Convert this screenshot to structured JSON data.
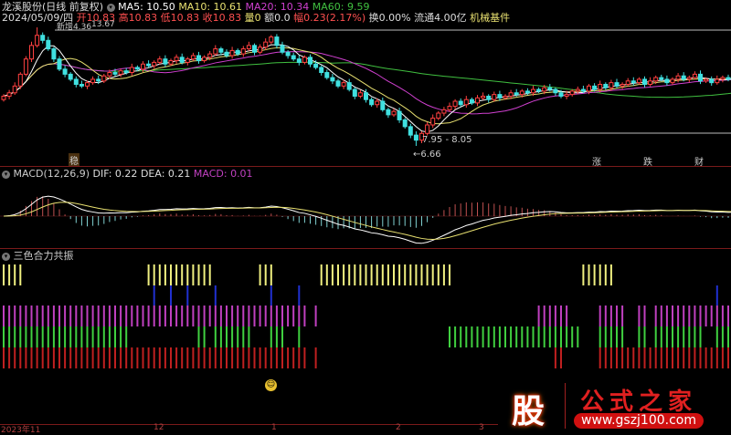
{
  "header": {
    "stock_name": "龙溪股份(日线 前复权)",
    "ma5": "MA5: 10.50",
    "ma10": "MA10: 10.61",
    "ma20": "MA20: 10.34",
    "ma60": "MA60: 9.59",
    "date": "2024/05/09/四",
    "open": "开10.83",
    "high": "高10.83",
    "low": "低10.83",
    "close": "收10.83",
    "volume": "量0",
    "amount": "额0.0",
    "change": "幅0.23(2.17%)",
    "turnover": "换0.00%",
    "float": "流通4.00亿",
    "sector": "机械基件"
  },
  "main_chart": {
    "high_label": "13.67",
    "low_label": "6.66",
    "range_label": "7.95 - 8.05",
    "top_note": "新增4.36",
    "signal_labels": [
      {
        "text": "稳",
        "color": "#d9a860"
      },
      {
        "text": "涨",
        "color": "#e05050"
      },
      {
        "text": "跌",
        "color": "#40d040"
      },
      {
        "text": "财",
        "color": "#80a8ff"
      }
    ],
    "closes": [
      9.6,
      9.8,
      10.2,
      10.9,
      11.8,
      12.6,
      13.2,
      12.9,
      12.4,
      11.8,
      11.2,
      10.9,
      10.6,
      10.3,
      10.2,
      10.4,
      10.6,
      10.5,
      10.8,
      11.0,
      10.9,
      11.1,
      11.0,
      11.3,
      11.2,
      11.5,
      11.4,
      11.6,
      11.8,
      11.5,
      11.7,
      11.9,
      11.6,
      11.8,
      12.0,
      11.7,
      11.9,
      12.1,
      12.4,
      12.2,
      12.0,
      12.3,
      12.1,
      12.4,
      12.6,
      12.2,
      12.5,
      12.8,
      13.1,
      12.6,
      12.2,
      12.0,
      11.8,
      11.6,
      11.9,
      11.5,
      11.3,
      11.0,
      10.7,
      10.5,
      10.2,
      10.4,
      10.0,
      9.6,
      9.8,
      9.4,
      9.1,
      9.3,
      8.8,
      8.5,
      8.7,
      8.2,
      7.8,
      7.3,
      7.0,
      7.4,
      7.9,
      8.3,
      8.6,
      8.8,
      9.0,
      9.3,
      9.1,
      9.4,
      9.2,
      9.5,
      9.6,
      9.4,
      9.7,
      9.5,
      9.6,
      9.8,
      9.7,
      9.9,
      9.8,
      10.0,
      9.9,
      10.1,
      10.0,
      9.8,
      9.6,
      9.7,
      9.9,
      10.0,
      9.9,
      10.2,
      10.0,
      10.3,
      10.1,
      10.4,
      10.2,
      10.3,
      10.5,
      10.4,
      10.6,
      10.3,
      10.5,
      10.7,
      10.6,
      10.4,
      10.6,
      10.8,
      10.6,
      10.7,
      10.9,
      10.5,
      10.6,
      10.4,
      10.6,
      10.7,
      10.6,
      10.83
    ],
    "colors": {
      "up": "#ff4040",
      "down": "#40e0e0",
      "ma5": "#ffffff",
      "ma10": "#e8e070",
      "ma20": "#d040d0",
      "ma60": "#40c040"
    }
  },
  "macd": {
    "title": "MACD(12,26,9)",
    "dif": "DIF: 0.22",
    "dea": "DEA: 0.21",
    "macd": "MACD: 0.01"
  },
  "tricolor": {
    "title": "三色合力共振",
    "rows": [
      {
        "name": "yellow",
        "color": "#f0f080",
        "ranges": [
          [
            0,
            3
          ],
          [
            26,
            37
          ],
          [
            46,
            48
          ],
          [
            57,
            80
          ],
          [
            104,
            109
          ]
        ]
      },
      {
        "name": "blue",
        "color": "#2030d0",
        "ranges": [
          [
            27,
            27
          ],
          [
            30,
            30
          ],
          [
            33,
            33
          ],
          [
            38,
            38
          ],
          [
            48,
            48
          ],
          [
            53,
            53
          ],
          [
            128,
            128
          ]
        ]
      },
      {
        "name": "magenta",
        "color": "#c040c0",
        "ranges": [
          [
            0,
            54
          ],
          [
            56,
            56
          ],
          [
            96,
            101
          ],
          [
            107,
            111
          ],
          [
            114,
            115
          ],
          [
            117,
            130
          ]
        ]
      },
      {
        "name": "green",
        "color": "#40d040",
        "ranges": [
          [
            0,
            22
          ],
          [
            35,
            36
          ],
          [
            38,
            44
          ],
          [
            48,
            50
          ],
          [
            53,
            53
          ],
          [
            80,
            103
          ],
          [
            107,
            111
          ],
          [
            114,
            115
          ],
          [
            117,
            125
          ],
          [
            128,
            130
          ]
        ]
      },
      {
        "name": "red",
        "color": "#c02020",
        "ranges": [
          [
            0,
            54
          ],
          [
            56,
            56
          ],
          [
            99,
            100
          ],
          [
            107,
            130
          ]
        ]
      }
    ]
  },
  "x_axis": {
    "labels": [
      "2023年11",
      "12",
      "1",
      "2",
      "3"
    ]
  },
  "watermark": {
    "brand": "公式之家",
    "badge": "股",
    "url": "www.gszj100.com"
  }
}
